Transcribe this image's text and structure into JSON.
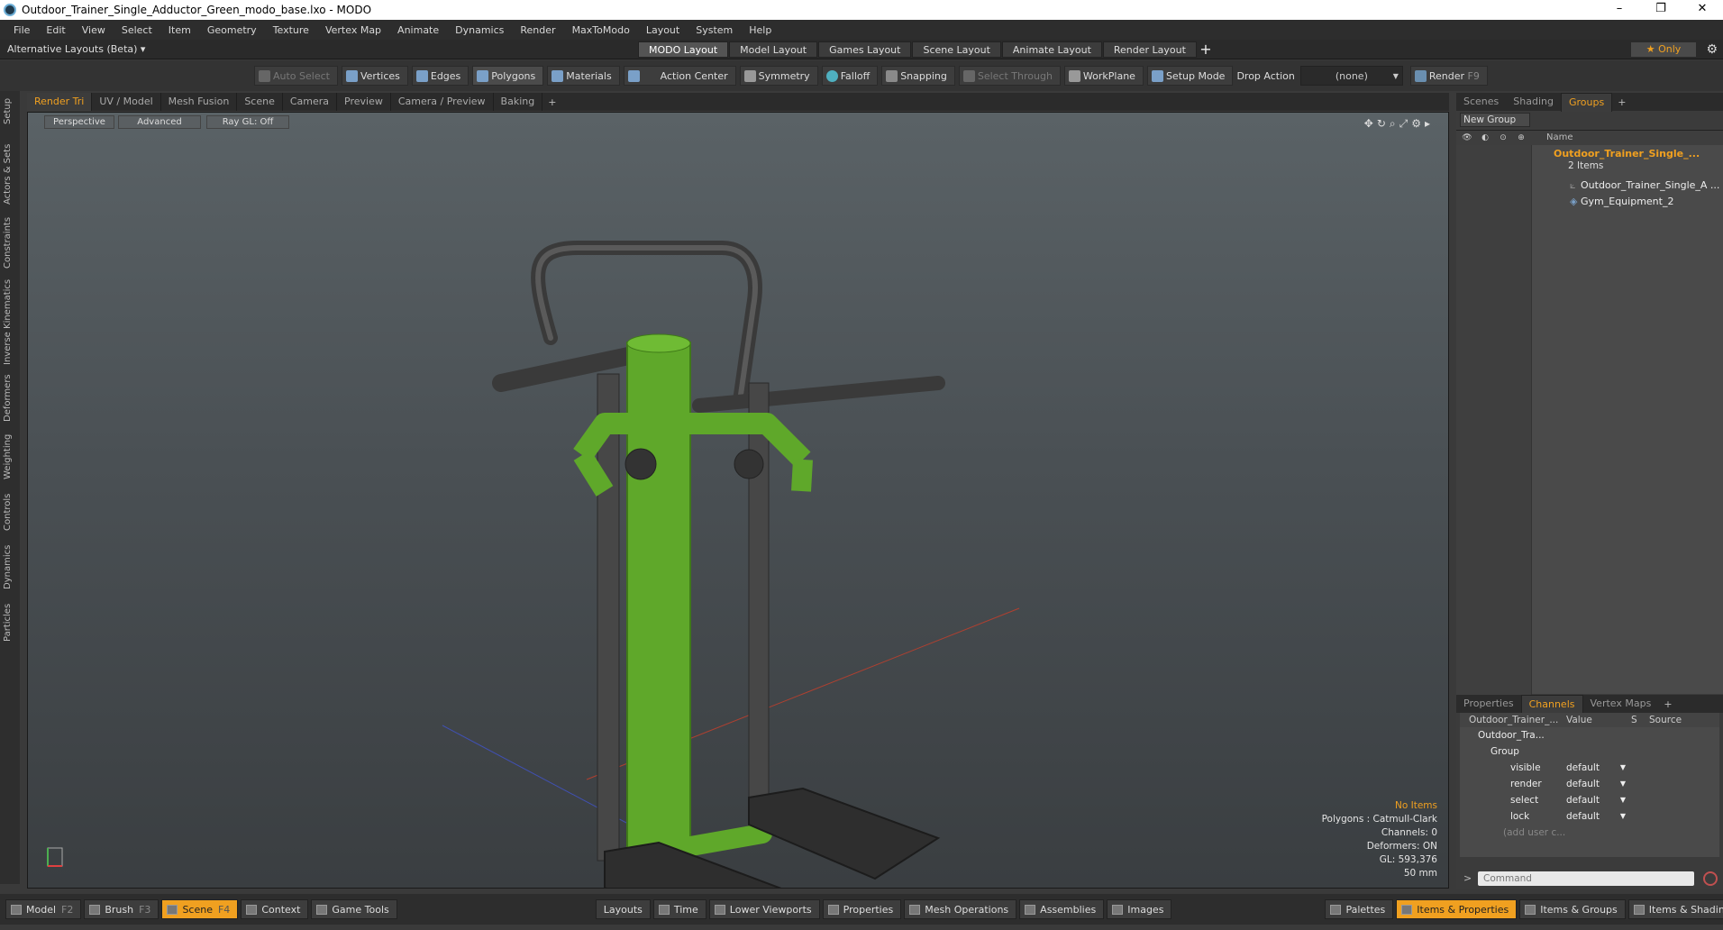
{
  "window": {
    "title": "Outdoor_Trainer_Single_Adductor_Green_modo_base.lxo - MODO",
    "controls": [
      "–",
      "❐",
      "✕"
    ]
  },
  "menu": [
    "File",
    "Edit",
    "View",
    "Select",
    "Item",
    "Geometry",
    "Texture",
    "Vertex Map",
    "Animate",
    "Dynamics",
    "Render",
    "MaxToModo",
    "Layout",
    "System",
    "Help"
  ],
  "layoutbar": {
    "alt_layouts": "Alternative Layouts (Beta) ▾",
    "tabs": [
      "MODO Layout",
      "Model Layout",
      "Games Layout",
      "Scene Layout",
      "Animate Layout",
      "Render Layout"
    ],
    "active_tab": "MODO Layout",
    "add": "+",
    "only": "★ Only"
  },
  "toolbar": {
    "auto_select": "Auto Select",
    "vertices": "Vertices",
    "edges": "Edges",
    "polygons": "Polygons",
    "materials": "Materials",
    "action_center": "Action Center",
    "symmetry": "Symmetry",
    "falloff": "Falloff",
    "snapping": "Snapping",
    "select_through": "Select Through",
    "workplane": "WorkPlane",
    "setup_mode": "Setup Mode",
    "drop_action_label": "Drop Action",
    "drop_action_value": "(none)",
    "render": "Render",
    "render_key": "F9"
  },
  "leftbar": [
    "Setup",
    "Actors & Sets",
    "Constraints",
    "Inverse Kinematics",
    "Deformers",
    "Weighting",
    "Controls",
    "Dynamics",
    "Particles"
  ],
  "viewport_tabs": [
    "Render Tri",
    "UV / Model",
    "Mesh Fusion",
    "Scene",
    "Camera",
    "Preview",
    "Camera / Preview",
    "Baking"
  ],
  "viewport_tabs_active": "Render Tri",
  "viewport": {
    "perspective": "Perspective",
    "advanced": "Advanced",
    "raygl": "Ray GL: Off",
    "info": {
      "no_items": "No Items",
      "polygons": "Polygons : Catmull-Clark",
      "channels": "Channels: 0",
      "deformers": "Deformers: ON",
      "gl": "GL: 593,376",
      "focal": "50 mm"
    },
    "colors": {
      "frame": "#222222",
      "green": "#5fa82a",
      "green_dark": "#3f7a18"
    }
  },
  "groups_panel": {
    "tabs": [
      "Scenes",
      "Shading",
      "Groups"
    ],
    "active": "Groups",
    "new_group": "New Group",
    "col_name": "Name",
    "group_name": "Outdoor_Trainer_Single_...",
    "group_count": "2 Items",
    "children": [
      "Outdoor_Trainer_Single_A ...",
      "Gym_Equipment_2"
    ]
  },
  "channels_panel": {
    "tabs": [
      "Properties",
      "Channels",
      "Vertex Maps"
    ],
    "active": "Channels",
    "headers": {
      "name": "Outdoor_Trainer_...",
      "value": "Value",
      "s": "S",
      "source": "Source"
    },
    "rows": [
      {
        "name": "Outdoor_Tra...",
        "value": ""
      },
      {
        "name": "Group",
        "value": ""
      },
      {
        "name": "visible",
        "value": "default"
      },
      {
        "name": "render",
        "value": "default"
      },
      {
        "name": "select",
        "value": "default"
      },
      {
        "name": "lock",
        "value": "default"
      },
      {
        "name": "(add user c...",
        "value": ""
      }
    ],
    "command_placeholder": "Command"
  },
  "statusbar": {
    "model": "Model",
    "model_key": "F2",
    "brush": "Brush",
    "brush_key": "F3",
    "scene": "Scene",
    "scene_key": "F4",
    "context": "Context",
    "game_tools": "Game Tools",
    "layouts": "Layouts",
    "time": "Time",
    "lower_viewports": "Lower Viewports",
    "properties": "Properties",
    "mesh_operations": "Mesh Operations",
    "assemblies": "Assemblies",
    "images": "Images",
    "palettes": "Palettes",
    "items_properties": "Items & Properties",
    "items_groups": "Items & Groups",
    "items_shading": "Items & Shading"
  }
}
